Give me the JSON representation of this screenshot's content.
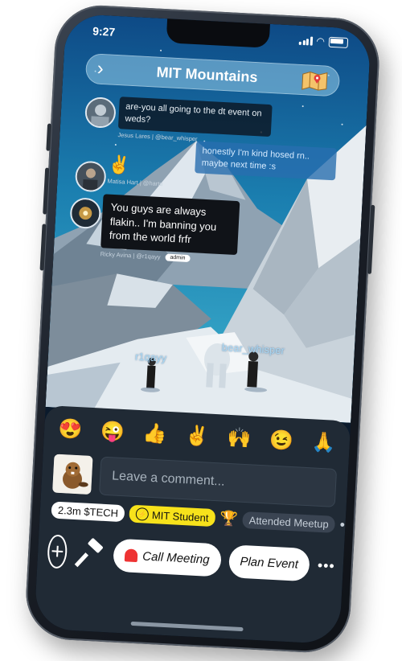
{
  "status_bar": {
    "time": "9:27"
  },
  "header": {
    "title": "MIT Mountains",
    "back_icon": "chevron-right-icon",
    "map_icon": "map-icon"
  },
  "messages": [
    {
      "text": "are-you all going to the dt event on weds?",
      "meta": "Jesus Lares | @bear_whisper"
    },
    {
      "text": "honestly I'm kind hosed rn.. maybe next time :s",
      "meta": ""
    },
    {
      "text": "✌️",
      "meta": "Matisa Hart | @harte"
    },
    {
      "text": "You guys are always flakin.. I'm banning you from the world frfr",
      "meta": "Ricky Avina | @r1qayy",
      "tag": "admin"
    }
  ],
  "players": [
    {
      "name": "r1qayy"
    },
    {
      "name": "bear_whisper"
    }
  ],
  "emojis": [
    "😍",
    "😜",
    "👍",
    "✌️",
    "🙌",
    "😉",
    "🙏"
  ],
  "comment": {
    "placeholder": "Leave a comment..."
  },
  "badges": {
    "tech": "2.3m $TECH",
    "mit": "MIT Student",
    "meetup": "Attended Meetup",
    "more": "•••"
  },
  "actions": {
    "call_meeting": "Call Meeting",
    "plan_event": "Plan Event",
    "more": "•••"
  },
  "colors": {
    "panel": "#202a35",
    "badge_yellow": "#f7e21b",
    "sky_top": "#0e4a86"
  }
}
